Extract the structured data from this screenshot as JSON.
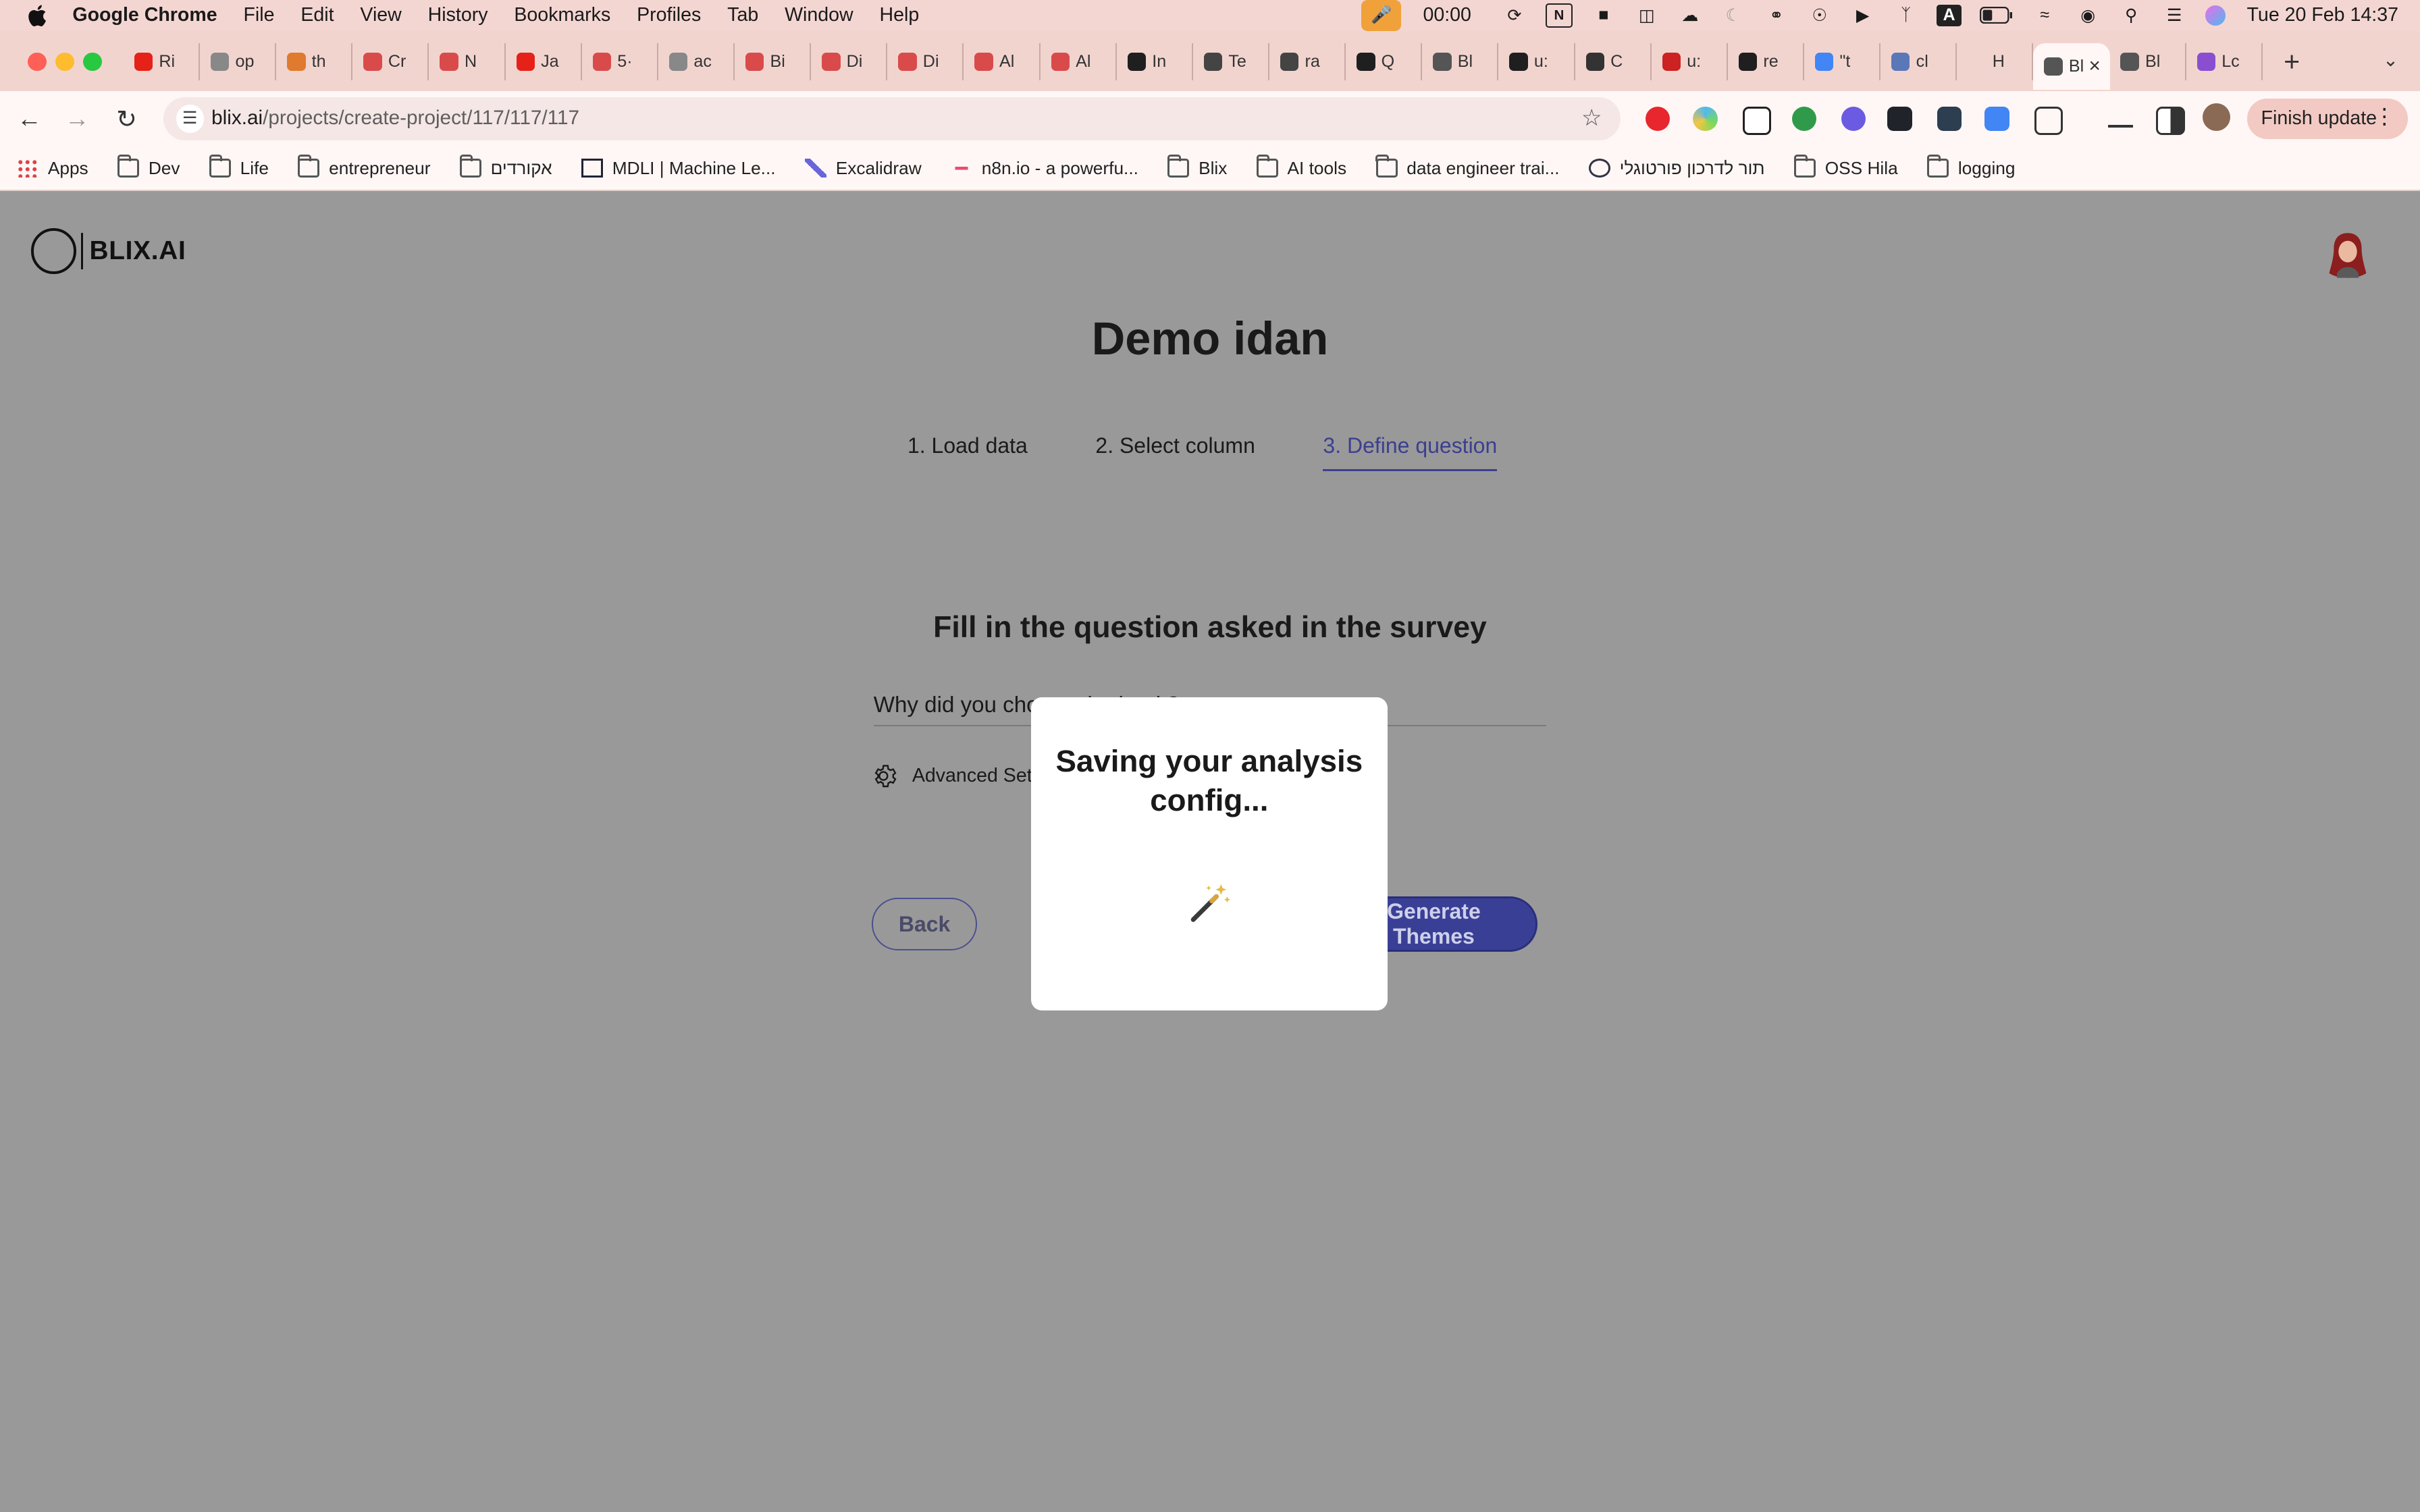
{
  "menubar": {
    "app_name": "Google Chrome",
    "items": [
      "File",
      "Edit",
      "View",
      "History",
      "Bookmarks",
      "Profiles",
      "Tab",
      "Window",
      "Help"
    ],
    "clock": "00:00",
    "date": "Tue 20 Feb  14:37"
  },
  "tabs": [
    {
      "label": "Ri",
      "color": "#e62117"
    },
    {
      "label": "op",
      "color": "#888888"
    },
    {
      "label": "th",
      "color": "#e07a2e"
    },
    {
      "label": "Cr",
      "color": "#d94b4b"
    },
    {
      "label": "N",
      "color": "#d94b4b"
    },
    {
      "label": "Ja",
      "color": "#e62117"
    },
    {
      "label": "5·",
      "color": "#d94b4b"
    },
    {
      "label": "ac",
      "color": "#888888"
    },
    {
      "label": "Bi",
      "color": "#d94b4b"
    },
    {
      "label": "Di",
      "color": "#d94b4b"
    },
    {
      "label": "Di",
      "color": "#d94b4b"
    },
    {
      "label": "Al",
      "color": "#d94b4b"
    },
    {
      "label": "Al",
      "color": "#d94b4b"
    },
    {
      "label": "In",
      "color": "#1f1f1f"
    },
    {
      "label": "Te",
      "color": "#444444"
    },
    {
      "label": "ra",
      "color": "#444444"
    },
    {
      "label": "Q",
      "color": "#1f1f1f"
    },
    {
      "label": "Bl",
      "color": "#555555"
    },
    {
      "label": "u:",
      "color": "#1f1f1f"
    },
    {
      "label": "C",
      "color": "#333333"
    },
    {
      "label": "u:",
      "color": "#cc2222"
    },
    {
      "label": "re",
      "color": "#1f1f1f"
    },
    {
      "label": "\"t",
      "color": "#4285f4"
    },
    {
      "label": "cl",
      "color": "#5a78b8"
    },
    {
      "label": "H",
      "color": "#f2d4cf"
    },
    {
      "label": "Bl",
      "color": "#555555",
      "active": true
    },
    {
      "label": "Bl",
      "color": "#555555"
    },
    {
      "label": "Lc",
      "color": "#8a4fd0"
    }
  ],
  "omnibox": {
    "domain": "blix.ai",
    "path": "/projects/create-project/117/117/117"
  },
  "toolbar": {
    "finish_update": "Finish update"
  },
  "bookmarks": [
    {
      "label": "Apps",
      "icon": "apps-grid-icon"
    },
    {
      "label": "Dev",
      "icon": "folder-icon"
    },
    {
      "label": "Life",
      "icon": "folder-icon"
    },
    {
      "label": "entrepreneur",
      "icon": "folder-icon"
    },
    {
      "label": "אקורדים",
      "icon": "folder-icon"
    },
    {
      "label": "MDLI | Machine Le...",
      "icon": "mdli-icon"
    },
    {
      "label": "Excalidraw",
      "icon": "excalidraw-icon"
    },
    {
      "label": "n8n.io - a powerfu...",
      "icon": "n8n-icon"
    },
    {
      "label": "Blix",
      "icon": "folder-icon"
    },
    {
      "label": "AI tools",
      "icon": "folder-icon"
    },
    {
      "label": "data engineer trai...",
      "icon": "folder-icon"
    },
    {
      "label": "תור לדרכון פורטוגלי",
      "icon": "site-icon"
    },
    {
      "label": "OSS Hila",
      "icon": "folder-icon"
    },
    {
      "label": "logging",
      "icon": "folder-icon"
    }
  ],
  "page": {
    "logo_text": "BLIX.AI",
    "project_title": "Demo idan",
    "steps": [
      {
        "label": "1.  Load data"
      },
      {
        "label": "2.  Select column"
      },
      {
        "label": "3.  Define question",
        "active": true
      }
    ],
    "question_heading": "Fill in the question asked in the survey",
    "question_value": "Why did you choose the book?",
    "advanced_settings": "Advanced Settings",
    "back_button": "Back",
    "generate_button": "Generate Themes"
  },
  "modal": {
    "message": "Saving your analysis config..."
  },
  "colors": {
    "accent": "#3a3f96",
    "overlay_gray": "#999999",
    "chrome_pink": "#f2d4cf"
  }
}
